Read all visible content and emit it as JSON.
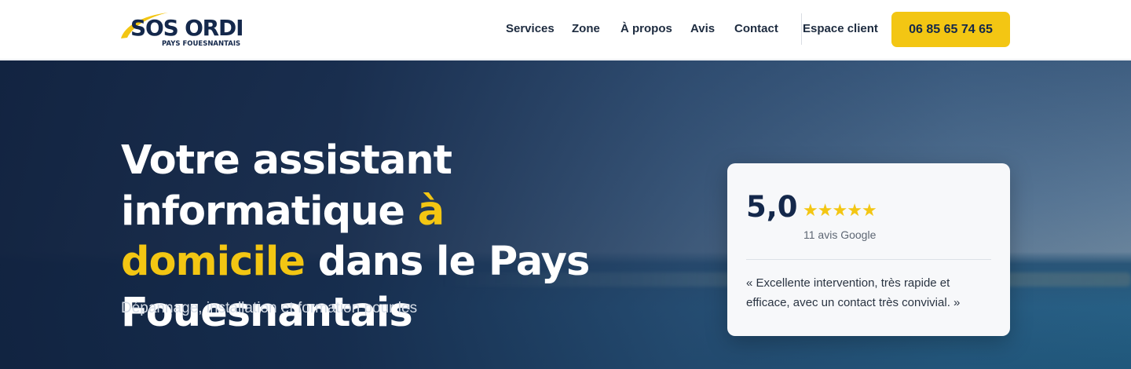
{
  "brand": {
    "name": "SOS ORDI",
    "tagline": "PAYS FOUESNANTAIS",
    "colors": {
      "navy": "#14284b",
      "yellow": "#f3c613"
    }
  },
  "nav": {
    "items": [
      {
        "label": "Services"
      },
      {
        "label": "Zone"
      },
      {
        "label": "À propos"
      },
      {
        "label": "Avis"
      },
      {
        "label": "Contact"
      }
    ],
    "client_area": "Espace client",
    "phone": "06 85 65 74 65"
  },
  "hero": {
    "title_part1": "Votre assistant informatique ",
    "title_accent": "à domicile",
    "title_part2": " dans le Pays Fouesnantais",
    "subtitle": "Dépannage, installation et formation pour les"
  },
  "review": {
    "score": "5,0",
    "stars": 5,
    "star_icon": "star-icon",
    "count_label": "11 avis Google",
    "quote": "« Excellente intervention, très rapide et efficace, avec un contact très convivial. »"
  }
}
